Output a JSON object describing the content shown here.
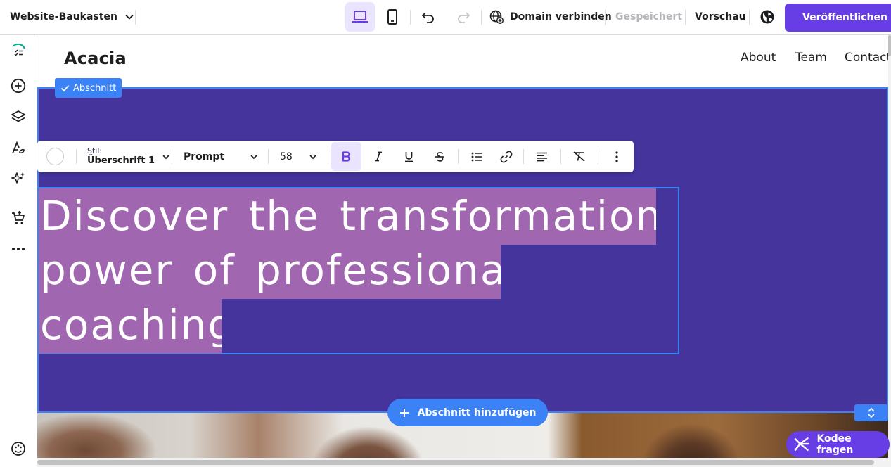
{
  "topbar": {
    "brand_label": "Website-Baukasten",
    "domain_label": "Domain verbinden",
    "saved_label": "Gespeichert",
    "preview_label": "Vorschau",
    "publish_label": "Veröffentlichen"
  },
  "site": {
    "logo": "Acacia",
    "nav": [
      "About",
      "Team",
      "Contact"
    ]
  },
  "section": {
    "tag_label": "Abschnitt",
    "add_section_label": "Abschnitt hinzufügen"
  },
  "text_toolbar": {
    "style_label": "Stil:",
    "style_value": "Überschrift 1",
    "font": "Prompt",
    "size": "58"
  },
  "headline": {
    "lines": [
      "Discover the transformational",
      "power of professional",
      "coaching"
    ]
  },
  "assistant": {
    "label": "Kodee fragen"
  },
  "colors": {
    "accent": "#673de6",
    "selection_blue": "#3b82f6",
    "hero_background": "#44349c",
    "text_highlight": "#a066b0"
  }
}
